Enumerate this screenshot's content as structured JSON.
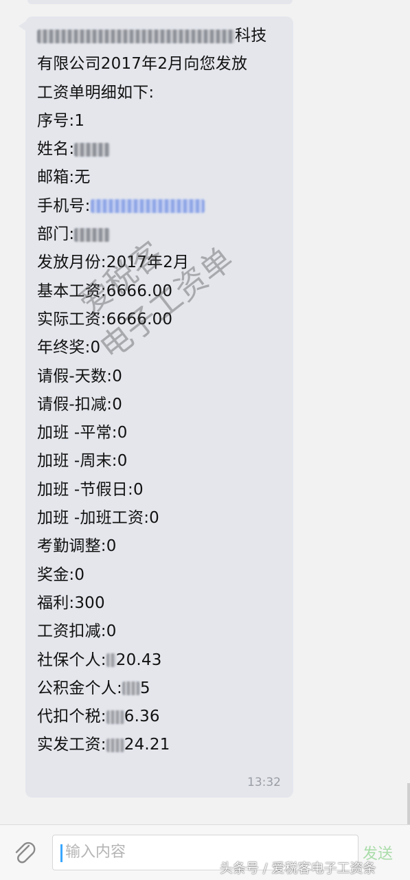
{
  "message": {
    "header_line1": "科技",
    "header_line2": "有限公司2017年2月向您发放",
    "header_line3": "工资单明细如下:",
    "serial": "序号:1",
    "name_label": "姓名:",
    "email": "邮箱:无",
    "phone_label": "手机号:",
    "dept_label": "部门:",
    "month": "发放月份:2017年2月",
    "base_salary": "基本工资:6666.00",
    "actual_salary": "实际工资:6666.00",
    "year_end_bonus": "年终奖:0",
    "leave_days": "请假-天数:0",
    "leave_deduction": "请假-扣减:0",
    "ot_weekday": "加班 -平常:0",
    "ot_weekend": "加班 -周末:0",
    "ot_holiday": "加班 -节假日:0",
    "ot_pay": "加班 -加班工资:0",
    "attendance_adj": "考勤调整:0",
    "bonus": "奖金:0",
    "welfare": "福利:300",
    "salary_deduction": "工资扣减:0",
    "social_security_label": "社保个人:",
    "social_security_tail": "20.43",
    "housing_fund_label": "公积金个人:",
    "housing_fund_tail": "5",
    "tax_label": "代扣个税:",
    "tax_tail": "6.36",
    "net_pay_label": "实发工资:",
    "net_pay_tail": "24.21",
    "timestamp": "13:32"
  },
  "watermark": {
    "line1": "爱税客",
    "line2": "电子工资单"
  },
  "input_bar": {
    "placeholder": "输入内容",
    "send_label": "发送",
    "attach_icon": "paperclip-icon"
  },
  "footer_watermark": "头条号 / 爱税客电子工资条"
}
